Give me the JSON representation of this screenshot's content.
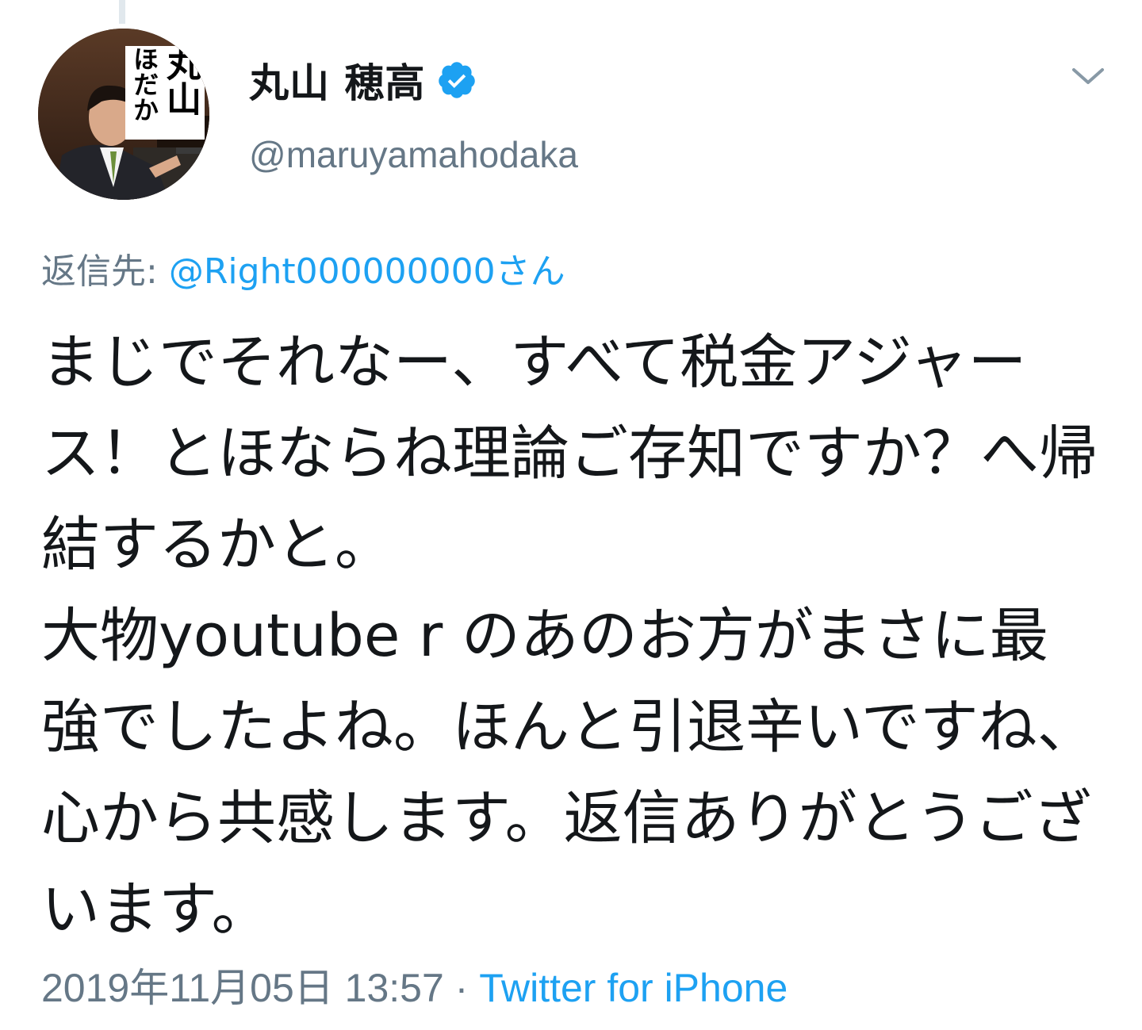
{
  "tweet": {
    "author": {
      "display_name": "丸山 穂高",
      "handle": "@maruyamahodaka",
      "verified": true,
      "avatar_text": [
        "丸山",
        "ほだか"
      ]
    },
    "reply_to": {
      "label": "返信先: ",
      "mention": "@Right000000000さん"
    },
    "text": "まじでそれなー、すべて税金アジャース！とほならね理論ご存知ですか？へ帰結するかと。\n大物youtube r のあのお方がまさに最強でしたよね。ほんと引退辛いですね、心から共感します。返信ありがとうございます。",
    "timestamp": "2019年11月05日 13:57",
    "separator": " · ",
    "source": "Twitter for iPhone"
  },
  "colors": {
    "accent": "#1da1f2",
    "text_primary": "#14171a",
    "text_secondary": "#657786",
    "thread_line": "#e1e8ed"
  },
  "icons": {
    "verified": "verified-badge-icon",
    "menu": "chevron-down-icon"
  }
}
